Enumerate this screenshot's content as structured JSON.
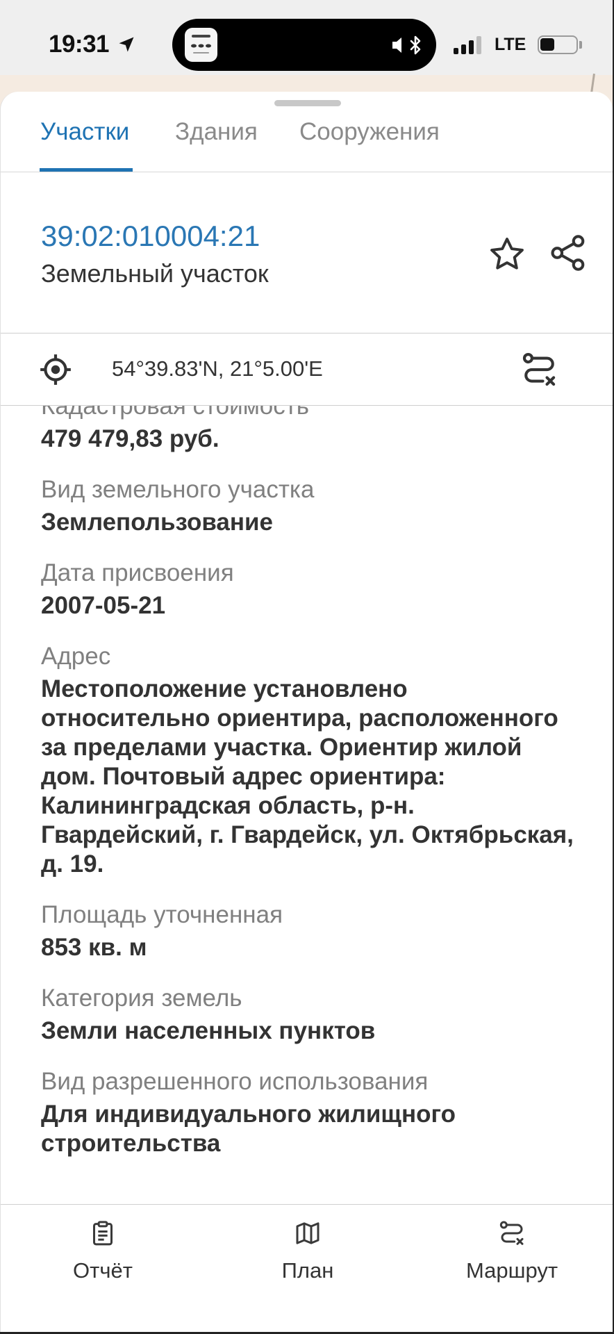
{
  "status_bar": {
    "time": "19:31",
    "network": "LTE",
    "signal_bars": 3,
    "signal_bars_total": 4,
    "battery_level": 0.4
  },
  "tabs": [
    {
      "label": "Участки",
      "active": true
    },
    {
      "label": "Здания",
      "active": false
    },
    {
      "label": "Сооружения",
      "active": false
    }
  ],
  "parcel": {
    "cadastral_number": "39:02:010004:21",
    "type": "Земельный участок"
  },
  "location": {
    "coordinates": "54°39.83'N, 21°5.00'E"
  },
  "details": [
    {
      "label": "Кадастровая стоимость",
      "value": "479 479,83 руб."
    },
    {
      "label": "Вид земельного участка",
      "value": "Землепользование"
    },
    {
      "label": "Дата присвоения",
      "value": "2007-05-21"
    },
    {
      "label": "Адрес",
      "value": "Местоположение установлено относительно ориентира, расположенного за пределами участка. Ориентир жилой дом. Почтовый адрес ориентира: Калининградская область, р-н. Гвардейский, г. Гвардейск, ул. Октябрьская, д. 19."
    },
    {
      "label": "Площадь уточненная",
      "value": "853 кв. м"
    },
    {
      "label": "Категория земель",
      "value": "Земли населенных пунктов"
    },
    {
      "label": "Вид разрешенного использования",
      "value": "Для индивидуального жилищного строительства"
    }
  ],
  "bottom_nav": [
    {
      "label": "Отчёт",
      "icon": "clipboard-icon"
    },
    {
      "label": "План",
      "icon": "map-icon"
    },
    {
      "label": "Маршрут",
      "icon": "route-icon"
    }
  ],
  "header_actions": {
    "favorite_icon": "star-icon",
    "share_icon": "share-icon",
    "locate_icon": "target-icon",
    "route_icon": "route-icon"
  },
  "colors": {
    "accent": "#1f73b3",
    "title": "#2a77b4",
    "label": "#808080",
    "value": "#333333",
    "map_background": "#f5ebe1"
  }
}
